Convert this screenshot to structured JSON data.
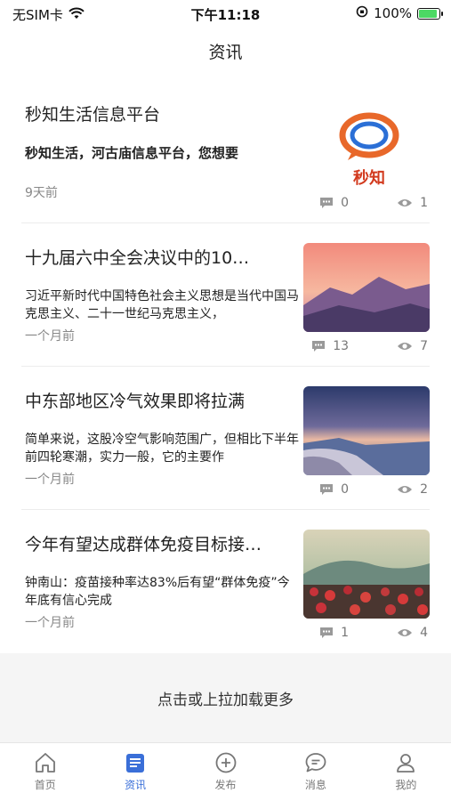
{
  "status_bar": {
    "carrier": "无SIM卡",
    "time": "下午11:18",
    "battery": "100%"
  },
  "nav": {
    "title": "资讯"
  },
  "news": [
    {
      "title": "秒知生活信息平台",
      "summary": "秒知生活，河古庙信息平台，您想要",
      "time": "9天前",
      "comments": "0",
      "views": "1",
      "thumb": "logo",
      "logo_text": "秒知"
    },
    {
      "title": "十九届六中全会决议中的10…",
      "summary": "习近平新时代中国特色社会主义思想是当代中国马克思主义、二十一世纪马克思主义，",
      "time": "一个月前",
      "comments": "13",
      "views": "7",
      "thumb": "mountain-sunset"
    },
    {
      "title": "中东部地区冷气效果即将拉满",
      "summary": "简单来说，这股冷空气影响范围广，但相比下半年前四轮寒潮，实力一般，它的主要作",
      "time": "一个月前",
      "comments": "0",
      "views": "2",
      "thumb": "coastal-town"
    },
    {
      "title": "今年有望达成群体免疫目标接…",
      "summary": "钟南山：疫苗接种率达83%后有望“群体免疫”今年底有信心完成",
      "time": "一个月前",
      "comments": "1",
      "views": "4",
      "thumb": "flower-field"
    }
  ],
  "load_more": "点击或上拉加载更多",
  "tabs": [
    {
      "label": "首页",
      "icon": "home-icon",
      "active": false
    },
    {
      "label": "资讯",
      "icon": "news-icon",
      "active": true
    },
    {
      "label": "发布",
      "icon": "add-circle-icon",
      "active": false
    },
    {
      "label": "消息",
      "icon": "message-icon",
      "active": false
    },
    {
      "label": "我的",
      "icon": "profile-icon",
      "active": false
    }
  ],
  "colors": {
    "accent": "#3a6fd8",
    "battery": "#4cd964"
  }
}
